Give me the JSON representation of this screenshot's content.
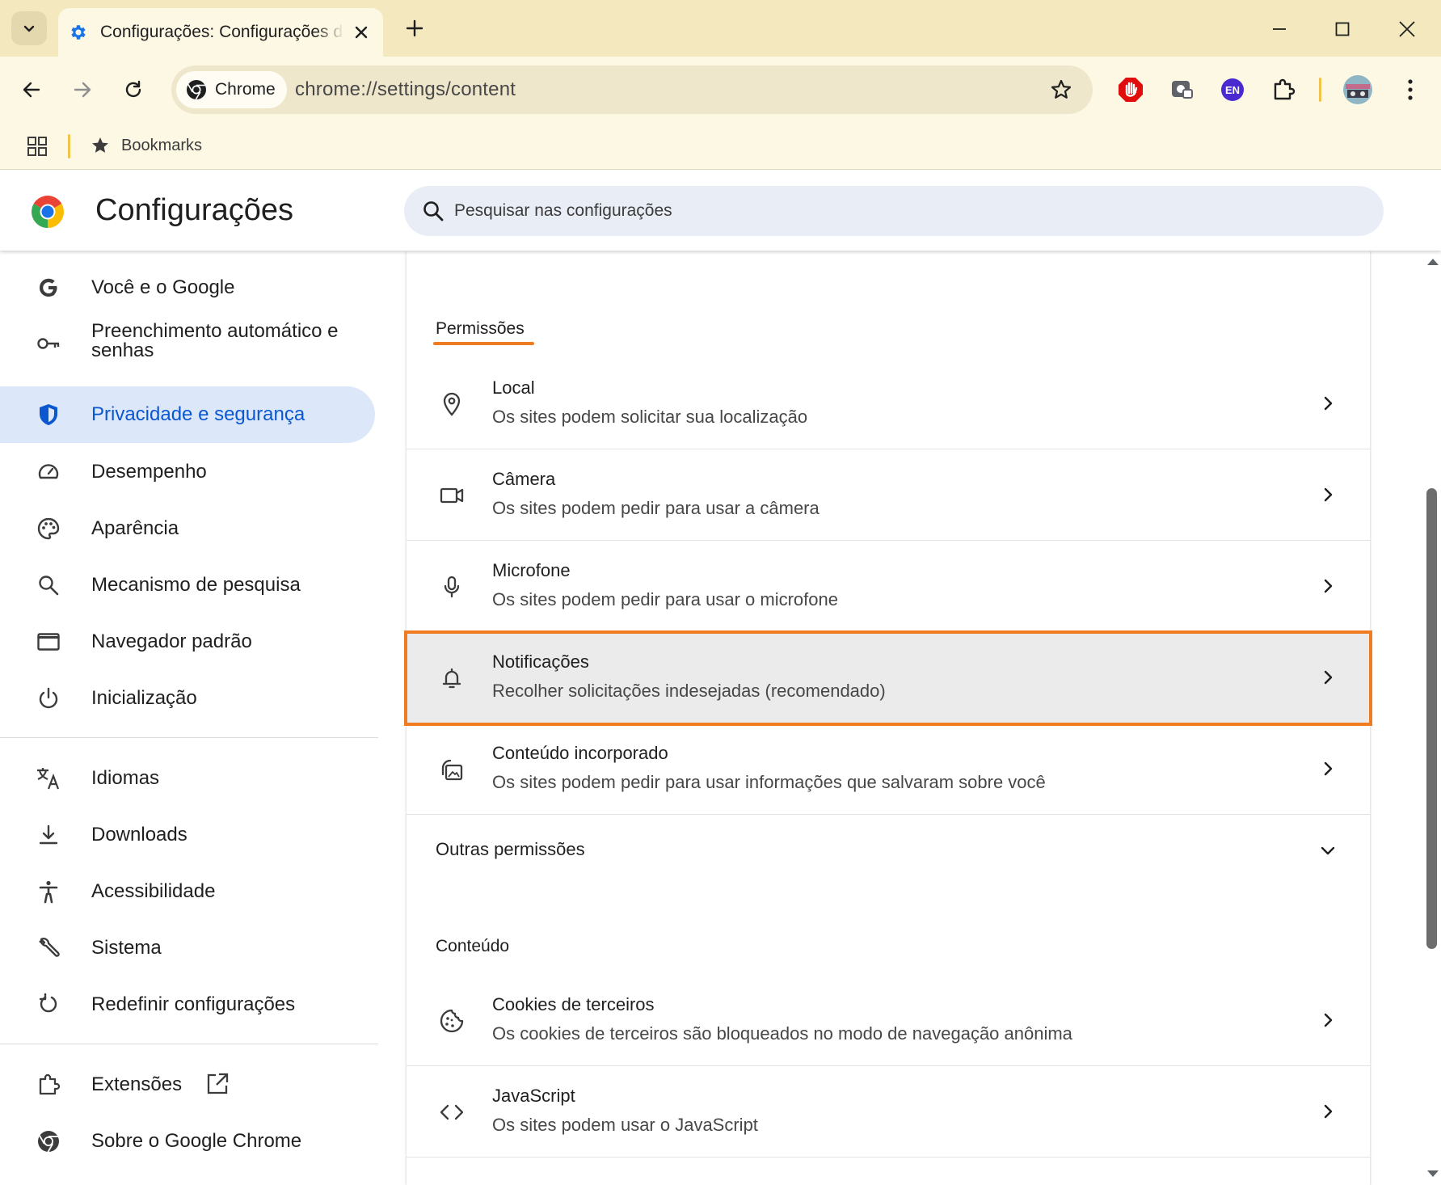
{
  "browser": {
    "tab_title": "Configurações: Configurações de conteúdo",
    "omnibox_chip": "Chrome",
    "url": "chrome://settings/content",
    "extension_badge": "EN",
    "bookmarks_label": "Bookmarks"
  },
  "header": {
    "title": "Configurações",
    "search_placeholder": "Pesquisar nas configurações"
  },
  "sidebar": {
    "items": [
      {
        "label": "Você e o Google",
        "icon": "google-g-icon"
      },
      {
        "label": "Preenchimento automático e senhas",
        "icon": "key-icon"
      },
      {
        "label": "Privacidade e segurança",
        "icon": "shield-icon",
        "active": true
      },
      {
        "label": "Desempenho",
        "icon": "speedometer-icon"
      },
      {
        "label": "Aparência",
        "icon": "palette-icon"
      },
      {
        "label": "Mecanismo de pesquisa",
        "icon": "search-icon"
      },
      {
        "label": "Navegador padrão",
        "icon": "browser-window-icon"
      },
      {
        "label": "Inicialização",
        "icon": "power-icon"
      },
      {
        "label": "Idiomas",
        "icon": "translate-icon"
      },
      {
        "label": "Downloads",
        "icon": "download-icon"
      },
      {
        "label": "Acessibilidade",
        "icon": "accessibility-icon"
      },
      {
        "label": "Sistema",
        "icon": "wrench-icon"
      },
      {
        "label": "Redefinir configurações",
        "icon": "reset-icon"
      },
      {
        "label": "Extensões",
        "icon": "puzzle-icon"
      },
      {
        "label": "Sobre o Google Chrome",
        "icon": "chrome-icon"
      }
    ]
  },
  "main": {
    "permissions_title": "Permissões",
    "permissions": [
      {
        "title": "Local",
        "subtitle": "Os sites podem solicitar sua localização",
        "icon": "location-pin-icon"
      },
      {
        "title": "Câmera",
        "subtitle": "Os sites podem pedir para usar a câmera",
        "icon": "camera-icon"
      },
      {
        "title": "Microfone",
        "subtitle": "Os sites podem pedir para usar o microfone",
        "icon": "microphone-icon"
      },
      {
        "title": "Notificações",
        "subtitle": "Recolher solicitações indesejadas (recomendado)",
        "icon": "bell-icon",
        "highlighted": true
      },
      {
        "title": "Conteúdo incorporado",
        "subtitle": "Os sites podem pedir para usar informações que salvaram sobre você",
        "icon": "embedded-content-icon"
      }
    ],
    "other_permissions_label": "Outras permissões",
    "content_title": "Conteúdo",
    "content": [
      {
        "title": "Cookies de terceiros",
        "subtitle": "Os cookies de terceiros são bloqueados no modo de navegação anônima",
        "icon": "cookie-icon"
      },
      {
        "title": "JavaScript",
        "subtitle": "Os sites podem usar o JavaScript",
        "icon": "code-icon"
      }
    ]
  },
  "colors": {
    "tabstrip": "#f3e8be",
    "toolbar": "#fcf8e4",
    "active_nav_bg": "#dce8fa",
    "active_nav_text": "#0b57d0",
    "highlight_border": "#f07c21"
  }
}
